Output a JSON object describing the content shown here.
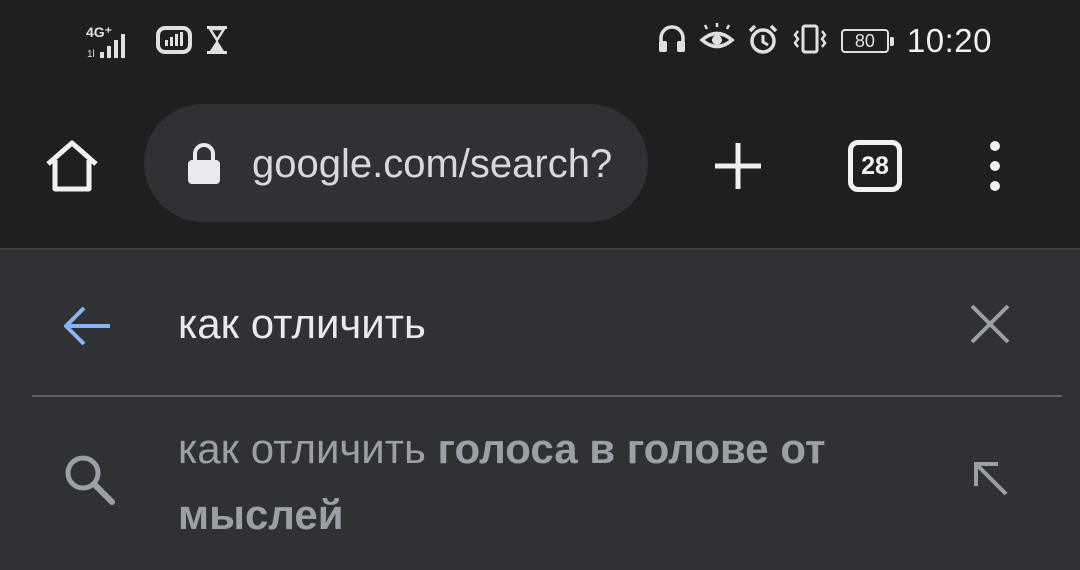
{
  "status_bar": {
    "network_label": "4G⁺",
    "time": "10:20",
    "battery_level": "80",
    "icons": [
      "signal-icon",
      "vpn-icon",
      "hourglass-icon",
      "headphones-icon",
      "eye-comfort-icon",
      "alarm-icon",
      "vibrate-icon",
      "battery-icon"
    ]
  },
  "toolbar": {
    "url": "google.com/search?",
    "tab_count": "28",
    "icons": [
      "home-icon",
      "lock-icon",
      "new-tab-icon",
      "tab-switcher-icon",
      "menu-icon"
    ]
  },
  "search": {
    "query": "как отличить",
    "suggestion_prefix": "как отличить ",
    "suggestion_bold": "голоса в голове от мыслей",
    "icons": [
      "back-arrow-icon",
      "clear-icon",
      "search-icon",
      "fill-query-icon"
    ]
  },
  "colors": {
    "status_bg": "#1f1f1f",
    "panel_bg": "#303134",
    "urlbar_bg": "#303134",
    "accent_blue": "#8ab4f8",
    "text_primary": "#e8eaed",
    "text_secondary": "#9aa0a6"
  }
}
